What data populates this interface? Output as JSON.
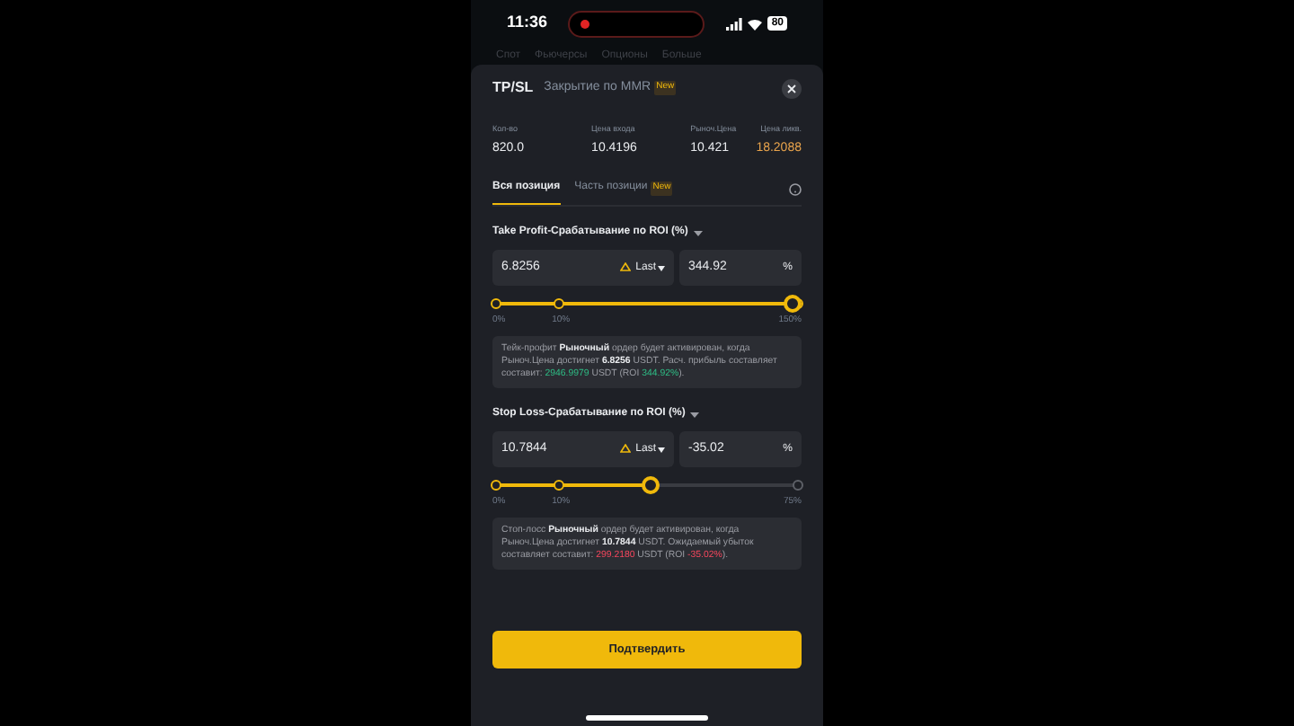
{
  "status_bar": {
    "time": "11:36",
    "battery": "80",
    "recording": true
  },
  "background_tabs": [
    "Спот",
    "Фьючерсы",
    "Опционы",
    "Больше"
  ],
  "sheet": {
    "title": "TP/SL",
    "subtitle": "Закрытие по MMR",
    "subtitle_badge": "New",
    "stats": [
      {
        "label": "Кол-во",
        "value": "820.0",
        "warning": false
      },
      {
        "label": "Цена входа",
        "value": "10.4196",
        "warning": false
      },
      {
        "label": "Рыноч.Цена",
        "value": "10.421",
        "warning": false
      },
      {
        "label": "Цена ликв.",
        "value": "18.2088",
        "warning": true
      }
    ],
    "tabs": [
      {
        "label": "Вся позиция",
        "selected": true
      },
      {
        "label": "Часть позиции",
        "selected": false,
        "badge": "New"
      }
    ],
    "sections": [
      {
        "title": "Take Profit-Срабатывание по ROI (%)",
        "price": "6.8256",
        "trigger": "Last",
        "roi": "344.92",
        "unit": "%",
        "level": 1.0,
        "marks": [
          "0%",
          "10%",
          "150%"
        ],
        "info": [
          {
            "kind": "plain",
            "text": "Тейк-профит "
          },
          {
            "kind": "bold",
            "text": "Рыночный"
          },
          {
            "kind": "plain",
            "text": " ордер будет активирован, когда Рыноч.Цена достигнет "
          },
          {
            "kind": "bold",
            "text": "6.8256"
          },
          {
            "kind": "plain",
            "text": " USDT. Расч. прибыль составляет составит: "
          },
          {
            "kind": "profit",
            "text": "2946.9979"
          },
          {
            "kind": "plain",
            "text": " USDT (ROI "
          },
          {
            "kind": "profit",
            "text": "344.92%"
          },
          {
            "kind": "plain",
            "text": ")."
          }
        ]
      },
      {
        "title": "Stop Loss-Срабатывание по ROI (%)",
        "price": "10.7844",
        "trigger": "Last",
        "roi": "-35.02",
        "unit": "%",
        "level": 0.51,
        "marks": [
          "0%",
          "10%",
          "75%"
        ],
        "info": [
          {
            "kind": "plain",
            "text": "Стоп-лосс "
          },
          {
            "kind": "bold",
            "text": "Рыночный"
          },
          {
            "kind": "plain",
            "text": " ордер будет активирован, когда Рыноч.Цена достигнет "
          },
          {
            "kind": "bold",
            "text": "10.7844"
          },
          {
            "kind": "plain",
            "text": " USDT. Ожидаемый убыток составляет составит: "
          },
          {
            "kind": "loss",
            "text": "299.2180"
          },
          {
            "kind": "plain",
            "text": " USDT (ROI "
          },
          {
            "kind": "loss",
            "text": "-35.02%"
          },
          {
            "kind": "plain",
            "text": ")."
          }
        ]
      }
    ],
    "confirm": "Подтвердить"
  }
}
